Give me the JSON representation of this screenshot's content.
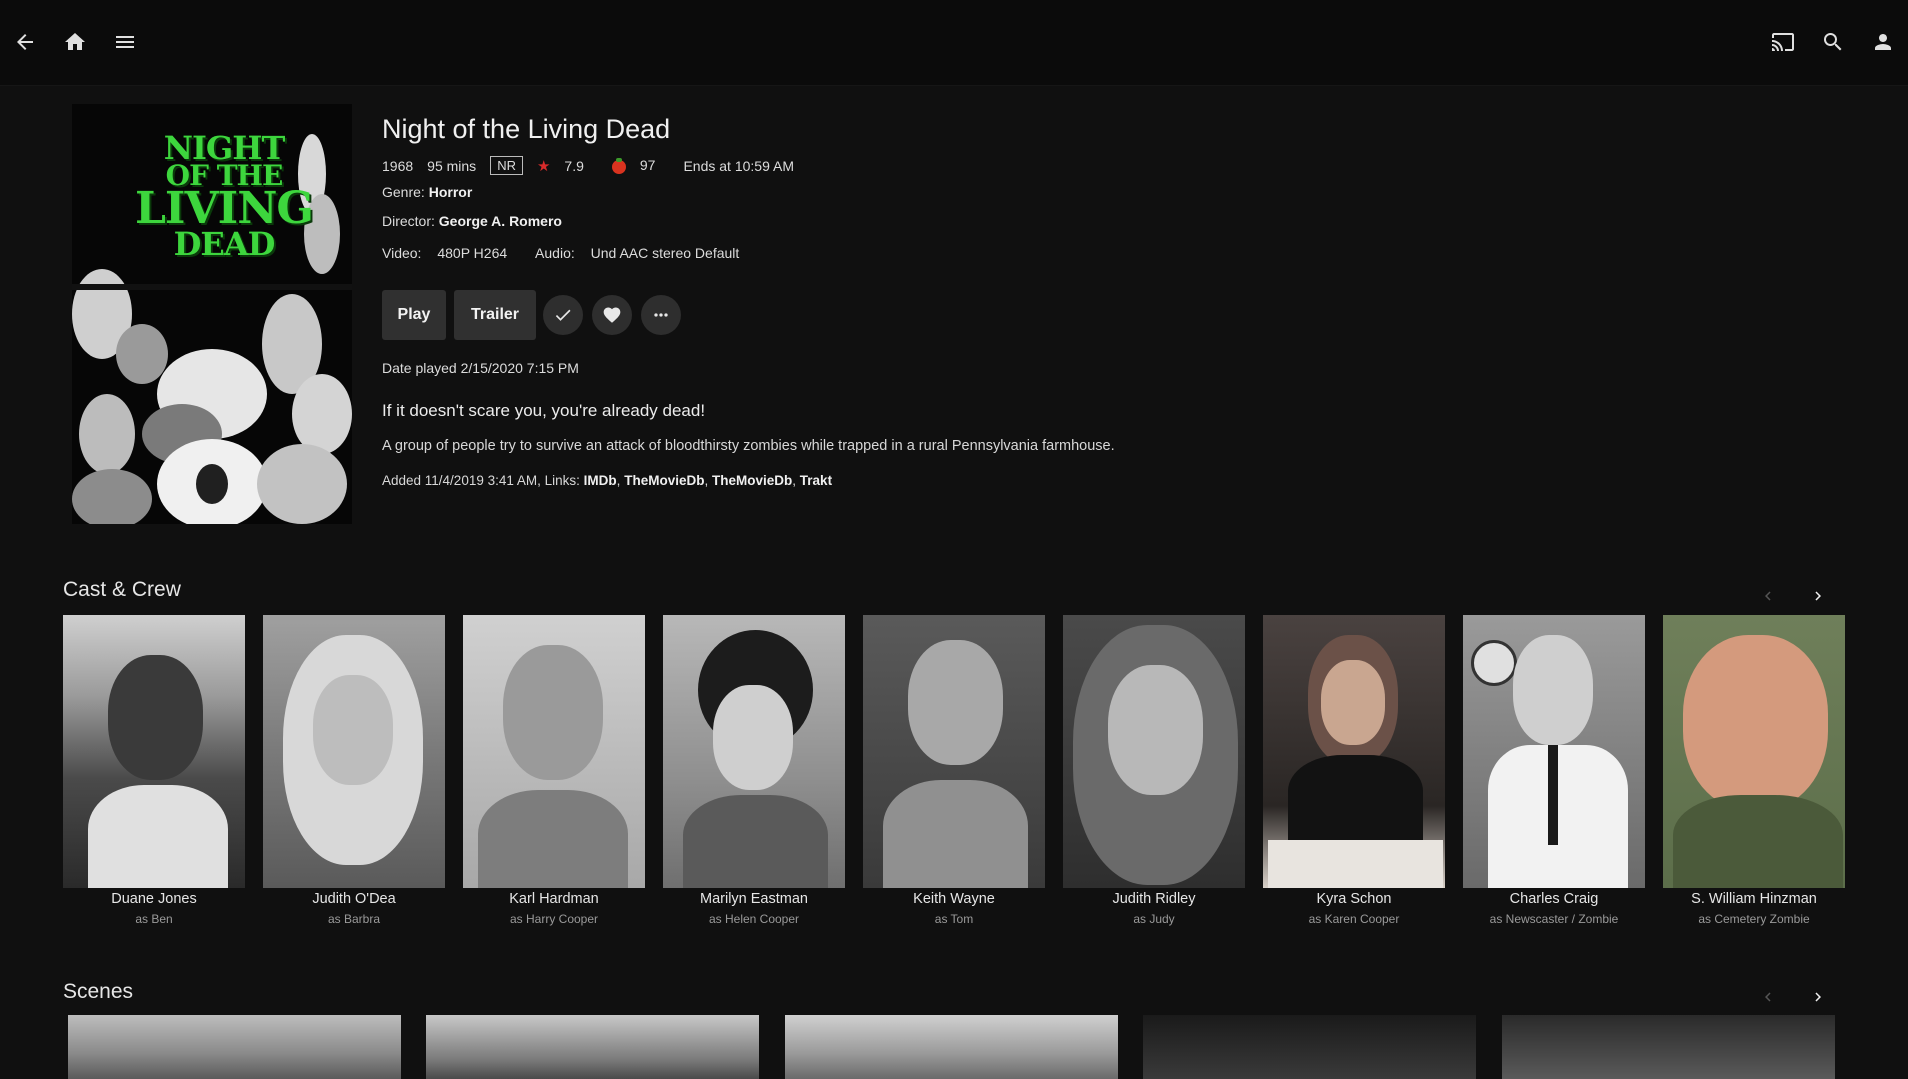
{
  "header": {
    "back_icon": "arrow-left-icon",
    "home_icon": "home-icon",
    "menu_icon": "hamburger-menu-icon",
    "cast_icon": "cast-icon",
    "search_icon": "search-icon",
    "user_icon": "person-icon"
  },
  "poster": {
    "line1": "NIGHT",
    "line2": "OF THE",
    "line3": "LIVING",
    "line4": "DEAD"
  },
  "movie": {
    "title": "Night of the Living Dead",
    "year": "1968",
    "runtime": "95 mins",
    "rating": "NR",
    "community_rating": "7.9",
    "critic_rating": "97",
    "ends_at": "Ends at 10:59 AM",
    "genre_label": "Genre:",
    "genre": "Horror",
    "director_label": "Director:",
    "director": "George A. Romero",
    "video_label": "Video:",
    "video": "480P H264",
    "audio_label": "Audio:",
    "audio": "Und AAC stereo Default",
    "play_label": "Play",
    "trailer_label": "Trailer",
    "date_played": "Date played 2/15/2020 7:15 PM",
    "tagline": "If it doesn't scare you, you're already dead!",
    "overview": "A group of people try to survive an attack of bloodthirsty zombies while trapped in a rural Pennsylvania farmhouse.",
    "added": "Added 11/4/2019 3:41 AM, Links:",
    "links": [
      "IMDb",
      "TheMovieDb",
      "TheMovieDb",
      "Trakt"
    ],
    "link_separator": ","
  },
  "cast_section": {
    "title": "Cast & Crew",
    "members": [
      {
        "name": "Duane Jones",
        "role": "as Ben"
      },
      {
        "name": "Judith O'Dea",
        "role": "as Barbra"
      },
      {
        "name": "Karl Hardman",
        "role": "as Harry Cooper"
      },
      {
        "name": "Marilyn Eastman",
        "role": "as Helen Cooper"
      },
      {
        "name": "Keith Wayne",
        "role": "as Tom"
      },
      {
        "name": "Judith Ridley",
        "role": "as Judy"
      },
      {
        "name": "Kyra Schon",
        "role": "as Karen Cooper"
      },
      {
        "name": "Charles Craig",
        "role": "as Newscaster / Zombie"
      },
      {
        "name": "S. William Hinzman",
        "role": "as Cemetery Zombie"
      }
    ]
  },
  "scenes_section": {
    "title": "Scenes"
  },
  "colors": {
    "background": "#101010",
    "topbar": "#0b0b0b",
    "button": "#303030",
    "poster_title_green": "#3dd63d",
    "star_red": "#d92b2b",
    "tomato_red": "#d9331f"
  }
}
